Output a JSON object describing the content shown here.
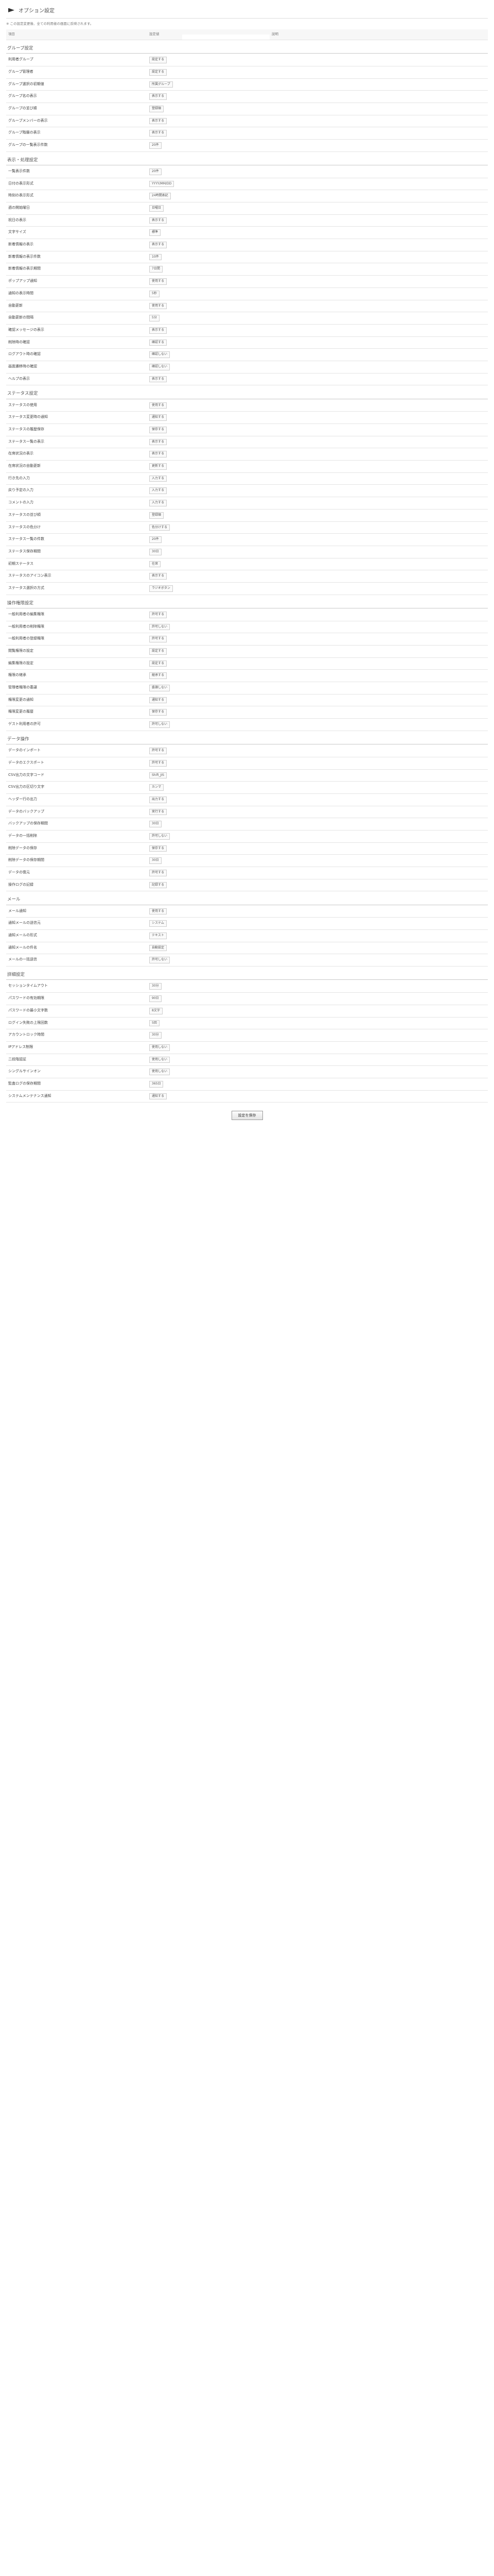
{
  "header": {
    "title": "オプション設定",
    "note": "※ この設定変更後、全ての利用者の画面に反映されます。"
  },
  "table_header": {
    "item": "項目",
    "value": "設定値",
    "desc": "説明"
  },
  "sections": [
    {
      "title": "グループ設定",
      "rows": [
        {
          "label": "利用者グループ",
          "value": "設定する"
        },
        {
          "label": "グループ管理者",
          "value": "設定する"
        },
        {
          "label": "グループ選択の初期値",
          "value": "所属グループ"
        },
        {
          "label": "グループ名の表示",
          "value": "表示する"
        },
        {
          "label": "グループの並び順",
          "value": "登録順"
        },
        {
          "label": "グループメンバーの表示",
          "value": "表示する"
        },
        {
          "label": "グループ階層の表示",
          "value": "表示する"
        },
        {
          "label": "グループの一覧表示件数",
          "value": "20件"
        }
      ]
    },
    {
      "title": "表示・処理設定",
      "rows": [
        {
          "label": "一覧表示件数",
          "value": "20件"
        },
        {
          "label": "日付の表示形式",
          "value": "YYYY/MM/DD"
        },
        {
          "label": "時刻の表示形式",
          "value": "24時間表記"
        },
        {
          "label": "週の開始曜日",
          "value": "日曜日"
        },
        {
          "label": "祝日の表示",
          "value": "表示する"
        },
        {
          "label": "文字サイズ",
          "value": "標準"
        },
        {
          "label": "新着情報の表示",
          "value": "表示する"
        },
        {
          "label": "新着情報の表示件数",
          "value": "10件"
        },
        {
          "label": "新着情報の表示期間",
          "value": "7日間"
        },
        {
          "label": "ポップアップ通知",
          "value": "使用する"
        },
        {
          "label": "通知の表示時間",
          "value": "5秒"
        },
        {
          "label": "自動更新",
          "value": "使用する"
        },
        {
          "label": "自動更新の間隔",
          "value": "5分"
        },
        {
          "label": "確認メッセージの表示",
          "value": "表示する"
        },
        {
          "label": "削除時の確認",
          "value": "確認する"
        },
        {
          "label": "ログアウト時の確認",
          "value": "確認しない"
        },
        {
          "label": "画面遷移時の確認",
          "value": "確認しない"
        },
        {
          "label": "ヘルプの表示",
          "value": "表示する"
        }
      ]
    },
    {
      "title": "ステータス設定",
      "rows": [
        {
          "label": "ステータスの使用",
          "value": "使用する"
        },
        {
          "label": "ステータス変更時の通知",
          "value": "通知する"
        },
        {
          "label": "ステータスの履歴保存",
          "value": "保存する"
        },
        {
          "label": "ステータス一覧の表示",
          "value": "表示する"
        },
        {
          "label": "在席状況の表示",
          "value": "表示する"
        },
        {
          "label": "在席状況の自動更新",
          "value": "更新する"
        },
        {
          "label": "行き先の入力",
          "value": "入力する"
        },
        {
          "label": "戻り予定の入力",
          "value": "入力する"
        },
        {
          "label": "コメントの入力",
          "value": "入力する"
        },
        {
          "label": "ステータスの並び順",
          "value": "登録順"
        },
        {
          "label": "ステータスの色分け",
          "value": "色分けする"
        },
        {
          "label": "ステータス一覧の件数",
          "value": "20件"
        },
        {
          "label": "ステータス保存期間",
          "value": "30日"
        },
        {
          "label": "初期ステータス",
          "value": "在席"
        },
        {
          "label": "ステータスのアイコン表示",
          "value": "表示する"
        },
        {
          "label": "ステータス選択の方式",
          "value": "ラジオボタン"
        }
      ]
    },
    {
      "title": "操作権限設定",
      "rows": [
        {
          "label": "一般利用者の編集権限",
          "value": "許可する"
        },
        {
          "label": "一般利用者の削除権限",
          "value": "許可しない"
        },
        {
          "label": "一般利用者の登録権限",
          "value": "許可する"
        },
        {
          "label": "閲覧権限の設定",
          "value": "設定する"
        },
        {
          "label": "編集権限の設定",
          "value": "設定する"
        },
        {
          "label": "権限の継承",
          "value": "継承する"
        },
        {
          "label": "管理者権限の委譲",
          "value": "委譲しない"
        },
        {
          "label": "権限変更の通知",
          "value": "通知する"
        },
        {
          "label": "権限変更の履歴",
          "value": "保存する"
        },
        {
          "label": "ゲスト利用者の許可",
          "value": "許可しない"
        }
      ]
    },
    {
      "title": "データ操作",
      "rows": [
        {
          "label": "データのインポート",
          "value": "許可する"
        },
        {
          "label": "データのエクスポート",
          "value": "許可する"
        },
        {
          "label": "CSV出力の文字コード",
          "value": "Shift_JIS"
        },
        {
          "label": "CSV出力の区切り文字",
          "value": "カンマ"
        },
        {
          "label": "ヘッダー行の出力",
          "value": "出力する"
        },
        {
          "label": "データのバックアップ",
          "value": "実行する"
        },
        {
          "label": "バックアップの保存期間",
          "value": "30日"
        },
        {
          "label": "データの一括削除",
          "value": "許可しない"
        },
        {
          "label": "削除データの保存",
          "value": "保存する"
        },
        {
          "label": "削除データの保存期間",
          "value": "30日"
        },
        {
          "label": "データの復元",
          "value": "許可する"
        },
        {
          "label": "操作ログの記録",
          "value": "記録する"
        }
      ]
    },
    {
      "title": "メール",
      "rows": [
        {
          "label": "メール通知",
          "value": "使用する"
        },
        {
          "label": "通知メールの送信元",
          "value": "システム"
        },
        {
          "label": "通知メールの形式",
          "value": "テキスト"
        },
        {
          "label": "通知メールの件名",
          "value": "自動設定"
        },
        {
          "label": "メールの一括送信",
          "value": "許可しない"
        }
      ]
    },
    {
      "title": "詳細設定",
      "rows": [
        {
          "label": "セッションタイムアウト",
          "value": "30分"
        },
        {
          "label": "パスワードの有効期限",
          "value": "90日"
        },
        {
          "label": "パスワードの最小文字数",
          "value": "8文字"
        },
        {
          "label": "ログイン失敗の上限回数",
          "value": "5回"
        },
        {
          "label": "アカウントロック時間",
          "value": "30分"
        },
        {
          "label": "IPアドレス制限",
          "value": "使用しない"
        },
        {
          "label": "二段階認証",
          "value": "使用しない"
        },
        {
          "label": "シングルサインオン",
          "value": "使用しない"
        },
        {
          "label": "監査ログの保存期間",
          "value": "365日"
        },
        {
          "label": "システムメンテナンス通知",
          "value": "通知する"
        }
      ]
    }
  ],
  "footer": {
    "save_label": "設定を保存"
  }
}
